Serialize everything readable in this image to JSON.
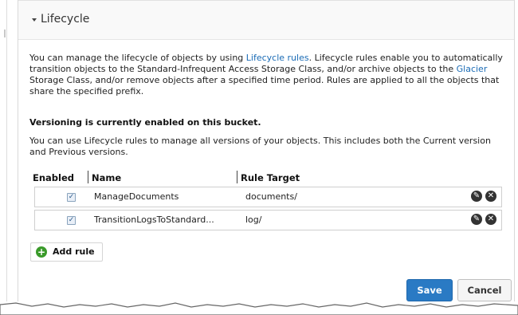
{
  "section": {
    "title": "Lifecycle"
  },
  "intro": {
    "text_a": "You can manage the lifecycle of objects by using ",
    "link_lifecycle": "Lifecycle rules",
    "text_b": ". Lifecycle rules enable you to automatically transition objects to the Standard-Infrequent Access Storage Class, and/or archive objects to the ",
    "link_glacier": "Glacier",
    "text_c": " Storage Class, and/or remove objects after a specified time period. Rules are applied to all the objects that share the specified prefix."
  },
  "versioning": {
    "status": "Versioning is currently enabled on this bucket.",
    "description": "You can use Lifecycle rules to manage all versions of your objects. This includes both the Current version and Previous versions."
  },
  "table": {
    "headers": {
      "enabled": "Enabled",
      "name": "Name",
      "target": "Rule Target"
    },
    "rows": [
      {
        "enabled": true,
        "name": "ManageDocuments",
        "target": "documents/",
        "check_glyph": "✓",
        "edit_icon": "pencil-icon",
        "delete_icon": "delete-icon"
      },
      {
        "enabled": true,
        "name": "TransitionLogsToStandard...",
        "target": "log/",
        "check_glyph": "✓",
        "edit_icon": "pencil-icon",
        "delete_icon": "delete-icon"
      }
    ]
  },
  "actions": {
    "add_rule": "Add rule",
    "save": "Save",
    "cancel": "Cancel"
  },
  "colors": {
    "link": "#1a6bb5",
    "save_button": "#2a7ac4",
    "add_icon": "#3a9a2a"
  }
}
